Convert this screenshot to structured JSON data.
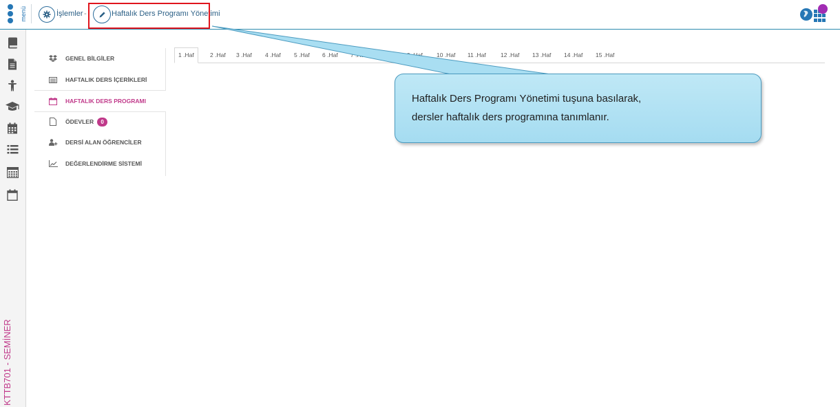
{
  "topbar": {
    "menu_label": "menü",
    "breadcrumb": [
      {
        "label": "İşlemler",
        "icon": "gear-icon"
      },
      {
        "label": "Haftalık Ders Programı Yönetimi",
        "icon": "pencil-icon"
      }
    ],
    "separator": "-",
    "accent_color": "#2677b5"
  },
  "rail": {
    "icons": [
      "book-icon",
      "document-icon",
      "person-icon",
      "graduation-cap-icon",
      "calendar-icon",
      "list-icon",
      "calculator-icon",
      "calendar-outline-icon"
    ],
    "course_code": "KTTB701 - SEMİNER"
  },
  "subnav": {
    "items": [
      {
        "label": "GENEL BİLGİLER",
        "icon": "dropbox-icon"
      },
      {
        "label": "HAFTALIK DERS İÇERİKLERİ",
        "icon": "list-box-icon"
      },
      {
        "label": "HAFTALIK DERS PROGRAMI",
        "icon": "calendar-icon",
        "active": true
      },
      {
        "label": "ÖDEVLER",
        "icon": "file-icon",
        "badge": "0"
      },
      {
        "label": "DERSİ ALAN ÖĞRENCİLER",
        "icon": "users-icon"
      },
      {
        "label": "DEĞERLENDİRME SİSTEMİ",
        "icon": "line-chart-icon"
      }
    ],
    "active_color": "#c0398a"
  },
  "tabs": {
    "items": [
      "1 .Haf",
      "2 .Haf",
      "3 .Haf",
      "4 .Haf",
      "5 .Haf",
      "6 .Haf",
      "7 .Haf",
      "8 .Haf",
      "9 .Haf",
      "10 .Haf",
      "11 .Haf",
      "12 .Haf",
      "13 .Haf",
      "14 .Haf",
      "15 .Haf"
    ],
    "active_index": 0
  },
  "callout": {
    "line1": "Haftalık Ders Programı Yönetimi tuşuna basılarak,",
    "line2": "dersler haftalık ders programına tanımlanır."
  }
}
